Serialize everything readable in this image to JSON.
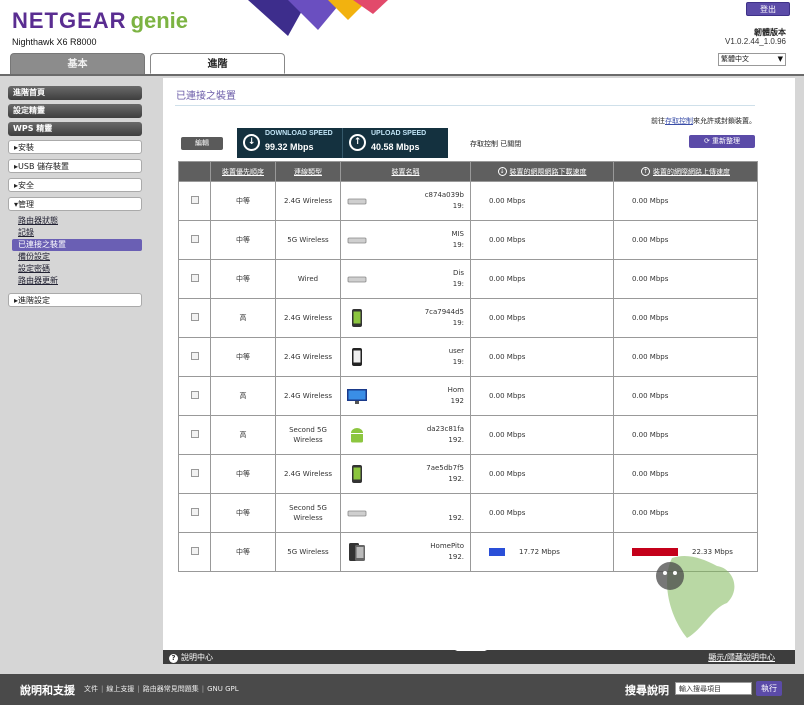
{
  "header": {
    "brand": "NETGEAR",
    "brand_suffix": "genie",
    "model": "Nighthawk X6 R8000",
    "logout": "登出",
    "firmware_label": "韌體版本",
    "firmware_version": "V1.0.2.44_1.0.96",
    "language": "繁體中文"
  },
  "tabs": {
    "basic": "基本",
    "advanced": "進階"
  },
  "sidebar": {
    "advanced_home": "進階首頁",
    "setup_wizard": "設定精靈",
    "wps_wizard": "WPS 精靈",
    "setup": "▸安裝",
    "usb_storage": "▸USB 儲存裝置",
    "security": "▸安全",
    "admin": "▾管理",
    "admin_items": [
      "路由器狀態",
      "記錄",
      "已連接之裝置",
      "備份設定",
      "設定密碼",
      "路由器更新"
    ],
    "advanced_setup": "▸進階設定"
  },
  "main": {
    "title": "已連接之裝置",
    "note_prefix": "前往",
    "note_link": "存取控制",
    "note_suffix": "來允許或封鎖裝置。",
    "edit": "編輯",
    "download_label": "DOWNLOAD SPEED",
    "download_value": "99.32 Mbps",
    "upload_label": "UPLOAD SPEED",
    "upload_value": "40.58 Mbps",
    "access_status": "存取控制 已關閉",
    "refresh": "重新整理"
  },
  "table": {
    "headers": {
      "priority": "裝置優先順序",
      "connection": "連線類型",
      "name": "裝置名稱",
      "download": "裝置的網際網路下載速度",
      "upload": "裝置的網際網路上傳速度"
    },
    "rows": [
      {
        "priority": "中等",
        "conn": "2.4G Wireless",
        "icon": "router-icon",
        "name": "c874a039b",
        "ip": "19:",
        "down": "0.00 Mbps",
        "up": "0.00 Mbps"
      },
      {
        "priority": "中等",
        "conn": "5G Wireless",
        "icon": "router-icon",
        "name": "MIS",
        "ip": "19:",
        "down": "0.00 Mbps",
        "up": "0.00 Mbps"
      },
      {
        "priority": "中等",
        "conn": "Wired",
        "icon": "router-icon",
        "name": "Dis",
        "ip": "19:",
        "down": "0.00 Mbps",
        "up": "0.00 Mbps"
      },
      {
        "priority": "高",
        "conn": "2.4G Wireless",
        "icon": "android-phone-icon",
        "name": "7ca7944d5",
        "ip": "19:",
        "down": "0.00 Mbps",
        "up": "0.00 Mbps"
      },
      {
        "priority": "中等",
        "conn": "2.4G Wireless",
        "icon": "phone-icon",
        "name": "user",
        "ip": "19:",
        "down": "0.00 Mbps",
        "up": "0.00 Mbps"
      },
      {
        "priority": "高",
        "conn": "2.4G Wireless",
        "icon": "monitor-icon",
        "name": "Hom",
        "ip": "192",
        "down": "0.00 Mbps",
        "up": "0.00 Mbps"
      },
      {
        "priority": "高",
        "conn": "Second 5G Wireless",
        "icon": "android-icon",
        "name": "da23c81fa",
        "ip": "192.",
        "down": "0.00 Mbps",
        "up": "0.00 Mbps"
      },
      {
        "priority": "中等",
        "conn": "2.4G Wireless",
        "icon": "android-phone-icon",
        "name": "7ae5db7f5",
        "ip": "192.",
        "down": "0.00 Mbps",
        "up": "0.00 Mbps"
      },
      {
        "priority": "中等",
        "conn": "Second 5G Wireless",
        "icon": "router-icon",
        "name": "",
        "ip": "192.",
        "down": "0.00 Mbps",
        "up": "0.00 Mbps"
      },
      {
        "priority": "中等",
        "conn": "5G Wireless",
        "icon": "tablet-icon",
        "name": "HomePito",
        "ip": "192.",
        "down": "17.72 Mbps",
        "up": "22.33 Mbps",
        "down_bar": true,
        "up_bar": true
      }
    ]
  },
  "help": {
    "center": "說明中心",
    "show": "顯示/隱藏說明中心"
  },
  "footer": {
    "support_title": "說明和支援",
    "links": [
      "文件",
      "線上支援",
      "路由器常見問題集",
      "GNU GPL"
    ],
    "search_title": "搜尋說明",
    "search_placeholder": "輸入搜尋項目",
    "search_button": "執行"
  },
  "colors": {
    "accent": "#5b4ba8",
    "brand": "#5a2d91",
    "genie": "#7cb342",
    "speed_box": "#14313f"
  }
}
